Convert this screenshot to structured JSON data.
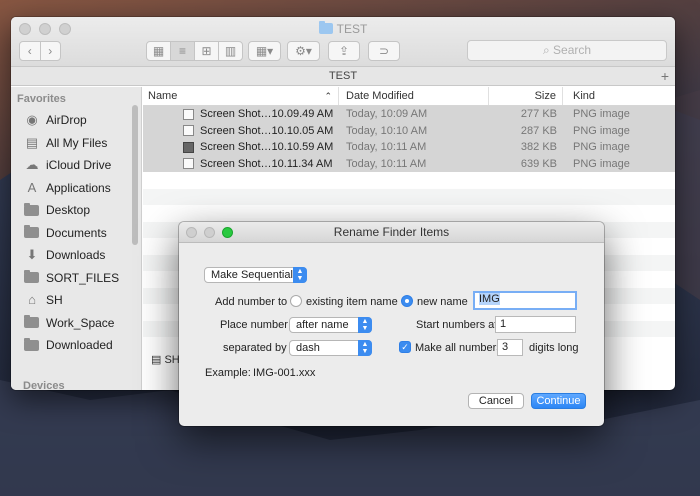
{
  "finder": {
    "title": "TEST",
    "path_title": "TEST",
    "search_placeholder": "Search",
    "sidebar": {
      "favorites_header": "Favorites",
      "items": [
        {
          "label": "AirDrop",
          "icon": "airdrop-icon"
        },
        {
          "label": "All My Files",
          "icon": "all-files-icon"
        },
        {
          "label": "iCloud Drive",
          "icon": "cloud-icon"
        },
        {
          "label": "Applications",
          "icon": "applications-icon"
        },
        {
          "label": "Desktop",
          "icon": "desktop-icon"
        },
        {
          "label": "Documents",
          "icon": "documents-icon"
        },
        {
          "label": "Downloads",
          "icon": "downloads-icon"
        },
        {
          "label": "SORT_FILES",
          "icon": "folder-icon"
        },
        {
          "label": "SH",
          "icon": "home-icon"
        },
        {
          "label": "Work_Space",
          "icon": "folder-icon"
        },
        {
          "label": "Downloaded",
          "icon": "folder-icon"
        }
      ],
      "devices_header": "Devices"
    },
    "columns": {
      "name": "Name",
      "date": "Date Modified",
      "size": "Size",
      "kind": "Kind"
    },
    "files": [
      {
        "name": "Screen Shot…10.09.49 AM",
        "date": "Today, 10:09 AM",
        "size": "277 KB",
        "kind": "PNG image"
      },
      {
        "name": "Screen Shot…10.10.05 AM",
        "date": "Today, 10:10 AM",
        "size": "287 KB",
        "kind": "PNG image"
      },
      {
        "name": "Screen Shot…10.10.59 AM",
        "date": "Today, 10:11 AM",
        "size": "382 KB",
        "kind": "PNG image"
      },
      {
        "name": "Screen Shot…10.11.34 AM",
        "date": "Today, 10:11 AM",
        "size": "639 KB",
        "kind": "PNG image"
      }
    ],
    "bottom_path": "SH"
  },
  "dialog": {
    "title": "Rename Finder Items",
    "mode_select": "Make Sequential",
    "add_number_to_label": "Add number to",
    "option_existing": "existing item name",
    "option_new": "new name",
    "new_name_value": "IMG",
    "place_number_label": "Place number",
    "place_number_value": "after name",
    "start_numbers_label": "Start numbers at",
    "start_numbers_value": "1",
    "separated_by_label": "separated by",
    "separated_by_value": "dash",
    "make_all_label": "Make all numbers",
    "digits_value": "3",
    "digits_long_label": "digits long",
    "example_label": "Example:",
    "example_value": "IMG-001.xxx",
    "cancel_label": "Cancel",
    "continue_label": "Continue"
  },
  "colors": {
    "accent": "#3c8cf0",
    "green": "#29c940",
    "selection": "#d5d5d5"
  }
}
